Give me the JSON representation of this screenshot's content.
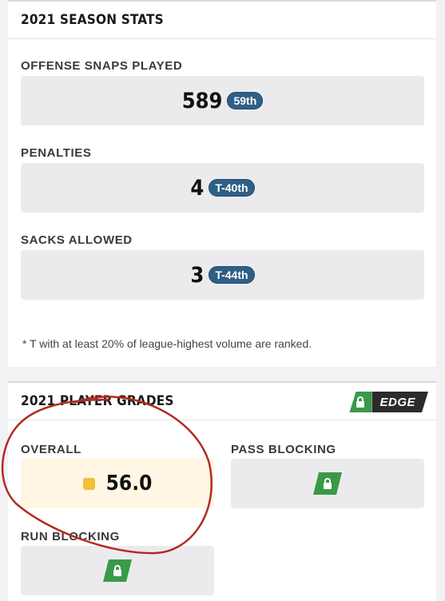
{
  "season_stats": {
    "title": "2021 SEASON STATS",
    "stats": [
      {
        "label": "OFFENSE SNAPS PLAYED",
        "value": "589",
        "rank": "59th"
      },
      {
        "label": "PENALTIES",
        "value": "4",
        "rank": "T-40th"
      },
      {
        "label": "SACKS ALLOWED",
        "value": "3",
        "rank": "T-44th"
      }
    ],
    "footnote": "* T with at least 20% of league-highest volume are ranked."
  },
  "player_grades": {
    "title": "2021 PLAYER GRADES",
    "edge_label": "EDGE",
    "overall": {
      "label": "OVERALL",
      "value": "56.0"
    },
    "pass_blocking": {
      "label": "PASS BLOCKING"
    },
    "run_blocking": {
      "label": "RUN BLOCKING"
    }
  },
  "colors": {
    "rank_badge": "#2f5f86",
    "lock_green": "#3a9a48",
    "grade_dot": "#f0c03a",
    "annotation_circle": "#b22a22"
  }
}
